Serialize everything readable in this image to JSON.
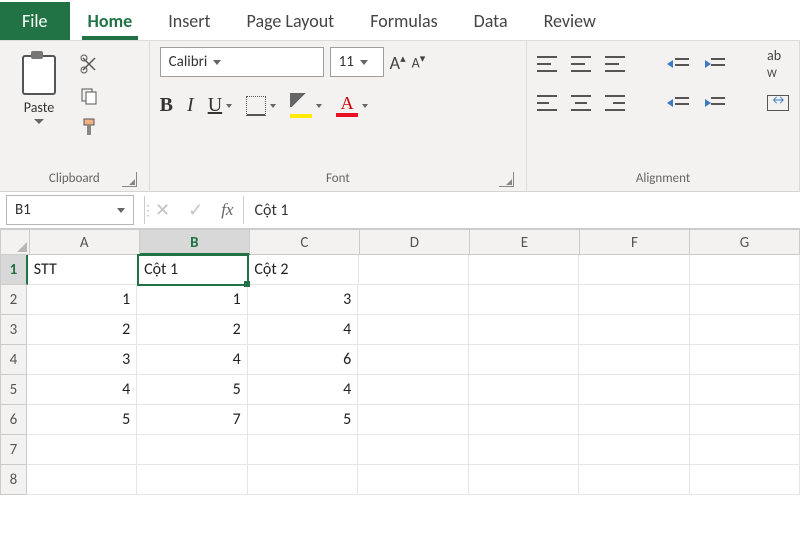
{
  "tabs": {
    "file": "File",
    "home": "Home",
    "insert": "Insert",
    "page_layout": "Page Layout",
    "formulas": "Formulas",
    "data": "Data",
    "review": "Review"
  },
  "ribbon": {
    "clipboard": {
      "label": "Clipboard",
      "paste": "Paste"
    },
    "font": {
      "label": "Font",
      "name": "Calibri",
      "size": "11",
      "bold": "B",
      "italic": "I",
      "underline": "U",
      "font_color_letter": "A"
    },
    "alignment": {
      "label": "Alignment",
      "wrap": "ab",
      "wrap2": "W"
    }
  },
  "formula_bar": {
    "name_box": "B1",
    "fx": "fx",
    "content": "Cột 1"
  },
  "grid": {
    "columns": [
      "A",
      "B",
      "C",
      "D",
      "E",
      "F",
      "G"
    ],
    "active": {
      "col": "B",
      "row": "1"
    },
    "rows": [
      {
        "n": "1",
        "cells": [
          {
            "v": "STT",
            "t": "txt"
          },
          {
            "v": "Cột 1",
            "t": "txt",
            "active": true
          },
          {
            "v": "Cột 2",
            "t": "txt"
          },
          {
            "v": ""
          },
          {
            "v": ""
          },
          {
            "v": ""
          },
          {
            "v": ""
          }
        ]
      },
      {
        "n": "2",
        "cells": [
          {
            "v": "1",
            "t": "num"
          },
          {
            "v": "1",
            "t": "num"
          },
          {
            "v": "3",
            "t": "num"
          },
          {
            "v": ""
          },
          {
            "v": ""
          },
          {
            "v": ""
          },
          {
            "v": ""
          }
        ]
      },
      {
        "n": "3",
        "cells": [
          {
            "v": "2",
            "t": "num"
          },
          {
            "v": "2",
            "t": "num"
          },
          {
            "v": "4",
            "t": "num"
          },
          {
            "v": ""
          },
          {
            "v": ""
          },
          {
            "v": ""
          },
          {
            "v": ""
          }
        ]
      },
      {
        "n": "4",
        "cells": [
          {
            "v": "3",
            "t": "num"
          },
          {
            "v": "4",
            "t": "num"
          },
          {
            "v": "6",
            "t": "num"
          },
          {
            "v": ""
          },
          {
            "v": ""
          },
          {
            "v": ""
          },
          {
            "v": ""
          }
        ]
      },
      {
        "n": "5",
        "cells": [
          {
            "v": "4",
            "t": "num"
          },
          {
            "v": "5",
            "t": "num"
          },
          {
            "v": "4",
            "t": "num"
          },
          {
            "v": ""
          },
          {
            "v": ""
          },
          {
            "v": ""
          },
          {
            "v": ""
          }
        ]
      },
      {
        "n": "6",
        "cells": [
          {
            "v": "5",
            "t": "num"
          },
          {
            "v": "7",
            "t": "num"
          },
          {
            "v": "5",
            "t": "num"
          },
          {
            "v": ""
          },
          {
            "v": ""
          },
          {
            "v": ""
          },
          {
            "v": ""
          }
        ]
      },
      {
        "n": "7",
        "cells": [
          {
            "v": ""
          },
          {
            "v": ""
          },
          {
            "v": ""
          },
          {
            "v": ""
          },
          {
            "v": ""
          },
          {
            "v": ""
          },
          {
            "v": ""
          }
        ]
      },
      {
        "n": "8",
        "cells": [
          {
            "v": ""
          },
          {
            "v": ""
          },
          {
            "v": ""
          },
          {
            "v": ""
          },
          {
            "v": ""
          },
          {
            "v": ""
          },
          {
            "v": ""
          }
        ]
      }
    ]
  }
}
